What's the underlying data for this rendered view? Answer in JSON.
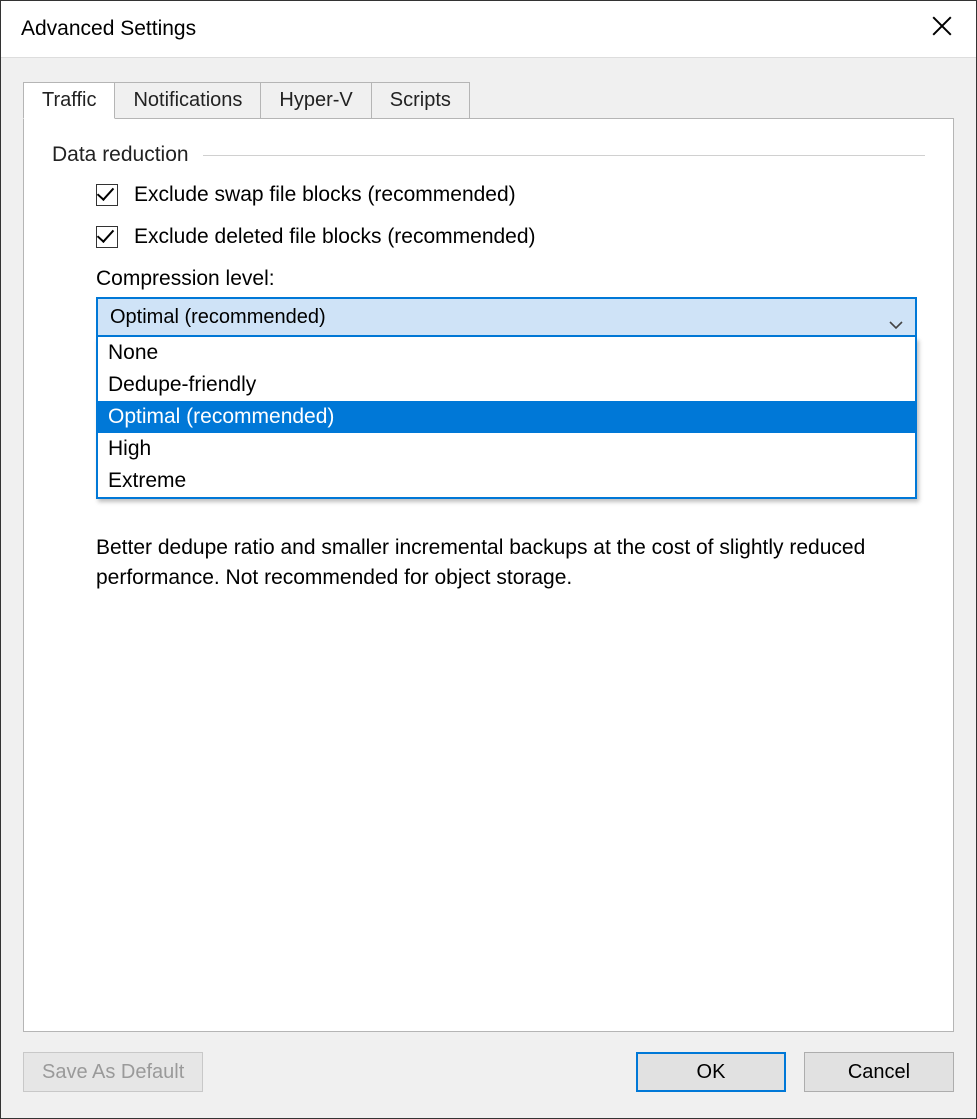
{
  "window": {
    "title": "Advanced Settings"
  },
  "tabs": [
    {
      "label": "Traffic",
      "active": true
    },
    {
      "label": "Notifications",
      "active": false
    },
    {
      "label": "Hyper-V",
      "active": false
    },
    {
      "label": "Scripts",
      "active": false
    }
  ],
  "traffic": {
    "group_label": "Data reduction",
    "exclude_swap": {
      "label": "Exclude swap file blocks (recommended)",
      "checked": true
    },
    "exclude_deleted": {
      "label": "Exclude deleted file blocks (recommended)",
      "checked": true
    },
    "compression": {
      "label": "Compression level:",
      "selected": "Optimal (recommended)",
      "options": [
        "None",
        "Dedupe-friendly",
        "Optimal (recommended)",
        "High",
        "Extreme"
      ],
      "helper": "Better dedupe ratio and smaller incremental backups at the cost of slightly reduced performance. Not recommended for object storage."
    }
  },
  "buttons": {
    "save_default": "Save As Default",
    "ok": "OK",
    "cancel": "Cancel"
  }
}
